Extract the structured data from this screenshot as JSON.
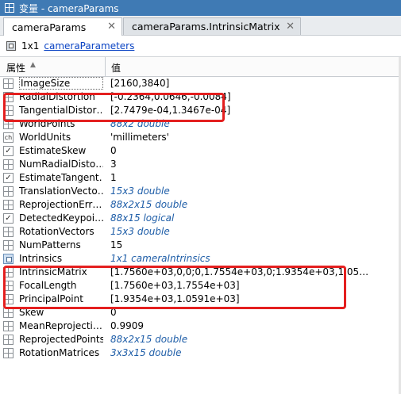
{
  "window": {
    "title": "变量 - cameraParams"
  },
  "tabs": [
    {
      "label": "cameraParams",
      "close": "✕"
    },
    {
      "label": "cameraParams.IntrinsicMatrix",
      "close": "✕"
    }
  ],
  "toolbar": {
    "size": "1x1",
    "class_link": "cameraParameters"
  },
  "table": {
    "header_name": "属性",
    "header_value": "值",
    "rows": [
      {
        "name": "ImageSize",
        "value": "[2160,3840]",
        "icon": "grid"
      },
      {
        "name": "RadialDistortion",
        "value": "[-0.2364,0.0646,-0.0084]",
        "icon": "grid"
      },
      {
        "name": "TangentialDistor…",
        "value": "[2.7479e-04,1.3467e-04]",
        "icon": "grid"
      },
      {
        "name": "WorldPoints",
        "value": "88x2 double",
        "icon": "grid"
      },
      {
        "name": "WorldUnits",
        "value": "'millimeters'",
        "icon": "ch"
      },
      {
        "name": "EstimateSkew",
        "value": "0",
        "icon": "check"
      },
      {
        "name": "NumRadialDisto…",
        "value": "3",
        "icon": "grid"
      },
      {
        "name": "EstimateTangent…",
        "value": "1",
        "icon": "check"
      },
      {
        "name": "TranslationVecto…",
        "value": "15x3 double",
        "icon": "grid"
      },
      {
        "name": "ReprojectionErr…",
        "value": "88x2x15 double",
        "icon": "grid"
      },
      {
        "name": "DetectedKeypoi…",
        "value": "88x15 logical",
        "icon": "check"
      },
      {
        "name": "RotationVectors",
        "value": "15x3 double",
        "icon": "grid"
      },
      {
        "name": "NumPatterns",
        "value": "15",
        "icon": "grid"
      },
      {
        "name": "Intrinsics",
        "value": "1x1 cameraIntrinsics",
        "icon": "obj"
      },
      {
        "name": "IntrinsicMatrix",
        "value": "[1.7560e+03,0,0;0,1.7554e+03,0;1.9354e+03,1.05…",
        "icon": "grid"
      },
      {
        "name": "FocalLength",
        "value": "[1.7560e+03,1.7554e+03]",
        "icon": "grid"
      },
      {
        "name": "PrincipalPoint",
        "value": "[1.9354e+03,1.0591e+03]",
        "icon": "grid"
      },
      {
        "name": "Skew",
        "value": "0",
        "icon": "grid"
      },
      {
        "name": "MeanReprojecti…",
        "value": "0.9909",
        "icon": "grid"
      },
      {
        "name": "ReprojectedPoints",
        "value": "88x2x15 double",
        "icon": "grid"
      },
      {
        "name": "RotationMatrices",
        "value": "3x3x15 double",
        "icon": "grid"
      }
    ]
  },
  "colors": {
    "titlebar": "#3f7ab4",
    "highlight": "#e41f1f",
    "link": "#0b44c4",
    "summary_value": "#1f5ea8"
  },
  "icons": {
    "title": "variable-editor-icon",
    "var": "struct-variable-icon",
    "sort": "sort-ascending-icon",
    "close": "close-icon"
  }
}
